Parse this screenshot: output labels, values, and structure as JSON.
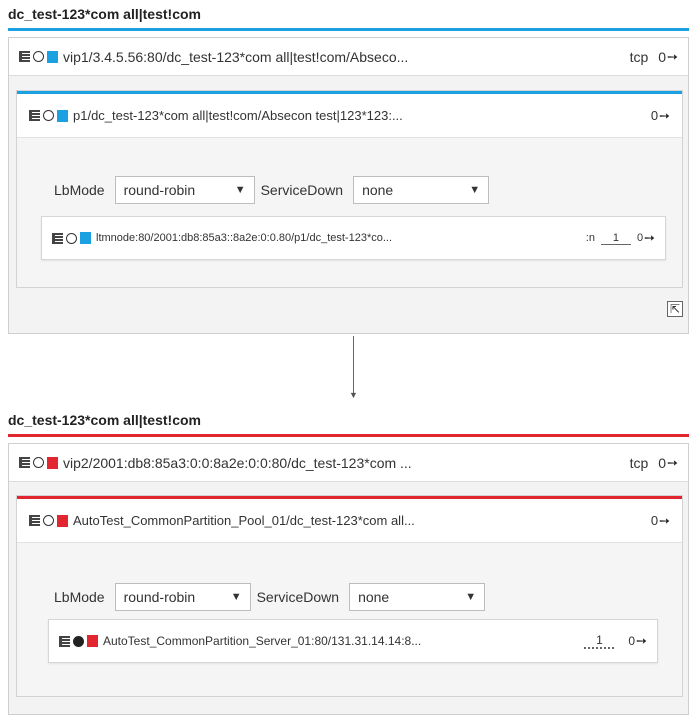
{
  "top": {
    "partition_title": "dc_test-123*com all|test!com",
    "accent_color": "#1ba1e2",
    "vip": {
      "label": "vip1/3.4.5.56:80/dc_test-123*com all|test!com/Abseco...",
      "protocol": "tcp",
      "count": "0"
    },
    "pool": {
      "label": "p1/dc_test-123*com all|test!com/Absecon test|123*123:...",
      "count": "0"
    },
    "lbmode_label": "LbMode",
    "lbmode_value": "round-robin",
    "servicedown_label": "ServiceDown",
    "servicedown_value": "none",
    "member": {
      "label": "ltmnode:80/2001:db8:85a3::8a2e:0:0.80/p1/dc_test-123*co...",
      "suffix": ":n",
      "weight": "1",
      "count": "0"
    }
  },
  "bottom": {
    "partition_title": "dc_test-123*com all|test!com",
    "accent_color": "#e22630",
    "vip": {
      "label": "vip2/2001:db8:85a3:0:0:8a2e:0:0:80/dc_test-123*com ...",
      "protocol": "tcp",
      "count": "0"
    },
    "pool": {
      "label": "AutoTest_CommonPartition_Pool_01/dc_test-123*com all...",
      "count": "0"
    },
    "lbmode_label": "LbMode",
    "lbmode_value": "round-robin",
    "servicedown_label": "ServiceDown",
    "servicedown_value": "none",
    "member": {
      "label": "AutoTest_CommonPartition_Server_01:80/131.31.14.14:8...",
      "weight": "1",
      "count": "0"
    }
  },
  "icons": {
    "pin": "pin-icon",
    "list": "list-icon",
    "status_circle": "circle-icon",
    "expand": "expand-icon"
  }
}
